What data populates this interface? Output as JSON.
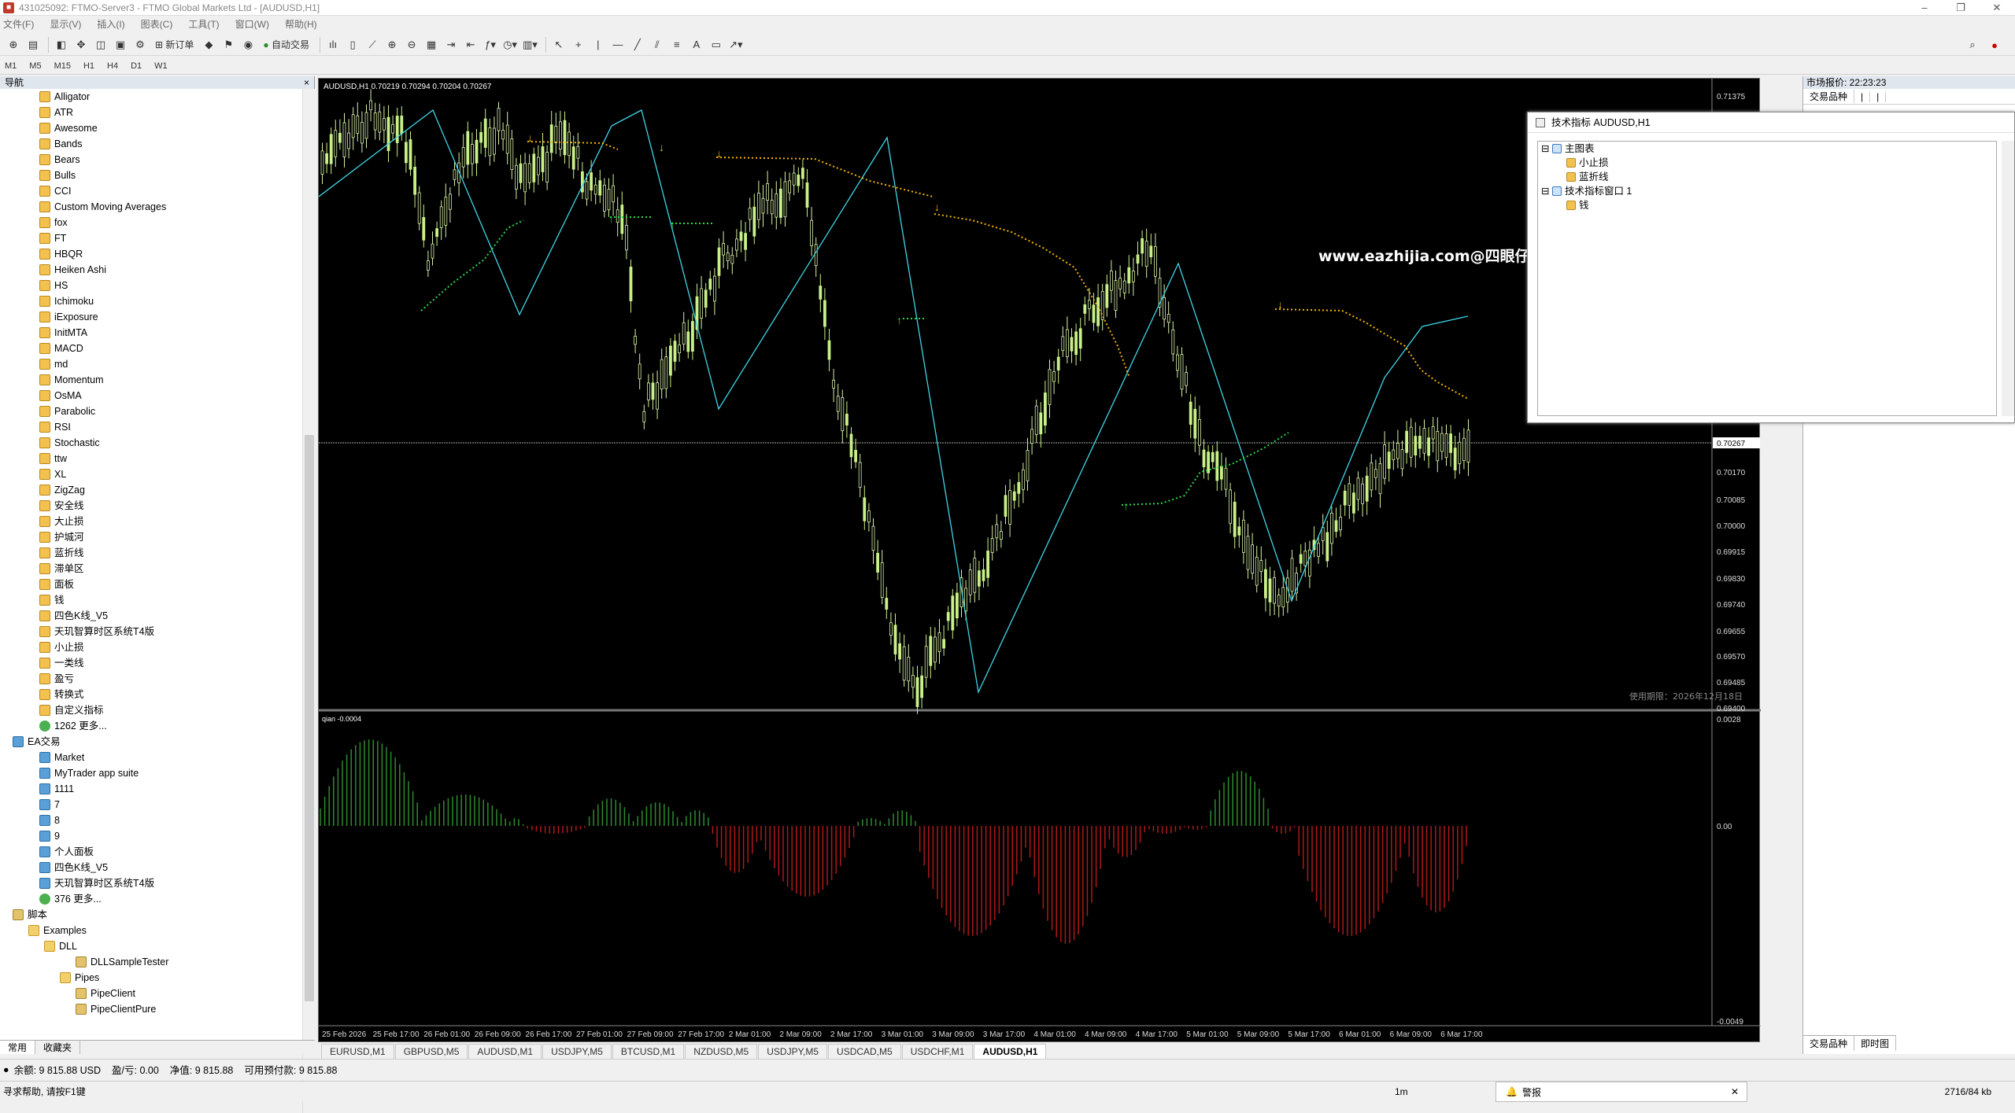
{
  "window": {
    "title": "431025092: FTMO-Server3 - FTMO Global Markets Ltd - [AUDUSD,H1]",
    "icon": "terminal-icon"
  },
  "menu": [
    "文件(F)",
    "显示(V)",
    "插入(I)",
    "图表(C)",
    "工具(T)",
    "窗口(W)",
    "帮助(H)"
  ],
  "toolbar": {
    "new_order": "新订单",
    "auto_trade": "自动交易"
  },
  "timeframes": [
    "M1",
    "M5",
    "M15",
    "H1",
    "H4",
    "D1",
    "W1"
  ],
  "navigator": {
    "title": "导航",
    "close": "×",
    "indicators": [
      "Alligator",
      "ATR",
      "Awesome",
      "Bands",
      "Bears",
      "Bulls",
      "CCI",
      "Custom Moving Averages",
      "fox",
      "FT",
      "HBQR",
      "Heiken Ashi",
      "HS",
      "Ichimoku",
      "iExposure",
      "InitMTA",
      "MACD",
      "md",
      "Momentum",
      "OsMA",
      "Parabolic",
      "RSI",
      "Stochastic",
      "ttw",
      "XL",
      "ZigZag",
      "安全线",
      "大止损",
      "护城河",
      "蓝折线",
      "滞单区",
      "面板",
      "钱",
      "四色K线_V5",
      "天玑智算时区系统T4版",
      "小止损",
      "一类线",
      "盈亏",
      "转换式",
      "自定义指标"
    ],
    "ind_more": "1262 更多...",
    "ea_folder": "EA交易",
    "ea_items": [
      "Market",
      "MyTrader app suite",
      "1111",
      "7",
      "8",
      "9",
      "个人面板",
      "四色K线_V5",
      "天玑智算时区系统T4版"
    ],
    "ea_more": "376 更多...",
    "scripts_folder": "脚本",
    "examples": "Examples",
    "dll": "DLL",
    "dll_item": "DLLSampleTester",
    "pipes": "Pipes",
    "pipe_items": [
      "PipeClient",
      "PipeClientPure"
    ],
    "tabs": [
      "常用",
      "收藏夹"
    ]
  },
  "chart": {
    "info": "AUDUSD,H1  0.70219 0.70294 0.70204 0.70267",
    "watermark": "www.eazhijia.com@四眼仔",
    "expiry": "使用期限：2026年12月18日",
    "sub_label": "qian -0.0004",
    "price_ticks": [
      "0.71375",
      "0.70267",
      "0.70170",
      "0.70085",
      "0.70000",
      "0.69915",
      "0.69830",
      "0.69740",
      "0.69655",
      "0.69570",
      "0.69485",
      "0.69400"
    ],
    "sub_ticks": [
      "0.0028",
      "0.00",
      "-0.0049"
    ],
    "time_ticks": [
      "25 Feb 2026",
      "25 Feb 17:00",
      "26 Feb 01:00",
      "26 Feb 09:00",
      "26 Feb 17:00",
      "27 Feb 01:00",
      "27 Feb 09:00",
      "27 Feb 17:00",
      "2 Mar 01:00",
      "2 Mar 09:00",
      "2 Mar 17:00",
      "3 Mar 01:00",
      "3 Mar 09:00",
      "3 Mar 17:00",
      "4 Mar 01:00",
      "4 Mar 09:00",
      "4 Mar 17:00",
      "5 Mar 01:00",
      "5 Mar 09:00",
      "5 Mar 17:00",
      "6 Mar 01:00",
      "6 Mar 09:00",
      "6 Mar 17:00"
    ],
    "current_price": "0.70267",
    "colors": {
      "bg": "#000000",
      "bull": "#c8f088",
      "bear": "#d8f0a8",
      "zigzag": "#3fd6e6",
      "ma_up": "#2dd64a",
      "ma_down": "#f2b300",
      "hist_pos": "#2e8b2e",
      "hist_neg": "#b01818"
    }
  },
  "chart_tabs": [
    "EURUSD,M1",
    "GBPUSD,M5",
    "AUDUSD,M1",
    "USDJPY,M5",
    "BTCUSD,M1",
    "NZDUSD,M5",
    "USDJPY,M5",
    "USDCAD,M5",
    "USDCHF,M1",
    "AUDUSD,H1"
  ],
  "market_watch": {
    "title": "市场报价: 22:23:23",
    "col": "交易品种",
    "tabs": [
      "交易品种",
      "即时图"
    ]
  },
  "indicator_window": {
    "title": "技术指标 AUDUSD,H1",
    "main": "主图表",
    "main_items": [
      "小止损",
      "蓝折线"
    ],
    "sub": "技术指标窗口 1",
    "sub_items": [
      "钱"
    ]
  },
  "status": {
    "balance": "余额: 9 815.88 USD",
    "profit": "盈/亏: 0.00",
    "equity": "净值: 9 815.88",
    "free": "可用预付款: 9 815.88"
  },
  "help": {
    "text": "寻求帮助, 请按F1键",
    "timeframe": "1m",
    "alarm": "警报",
    "net": "2716/84 kb"
  }
}
